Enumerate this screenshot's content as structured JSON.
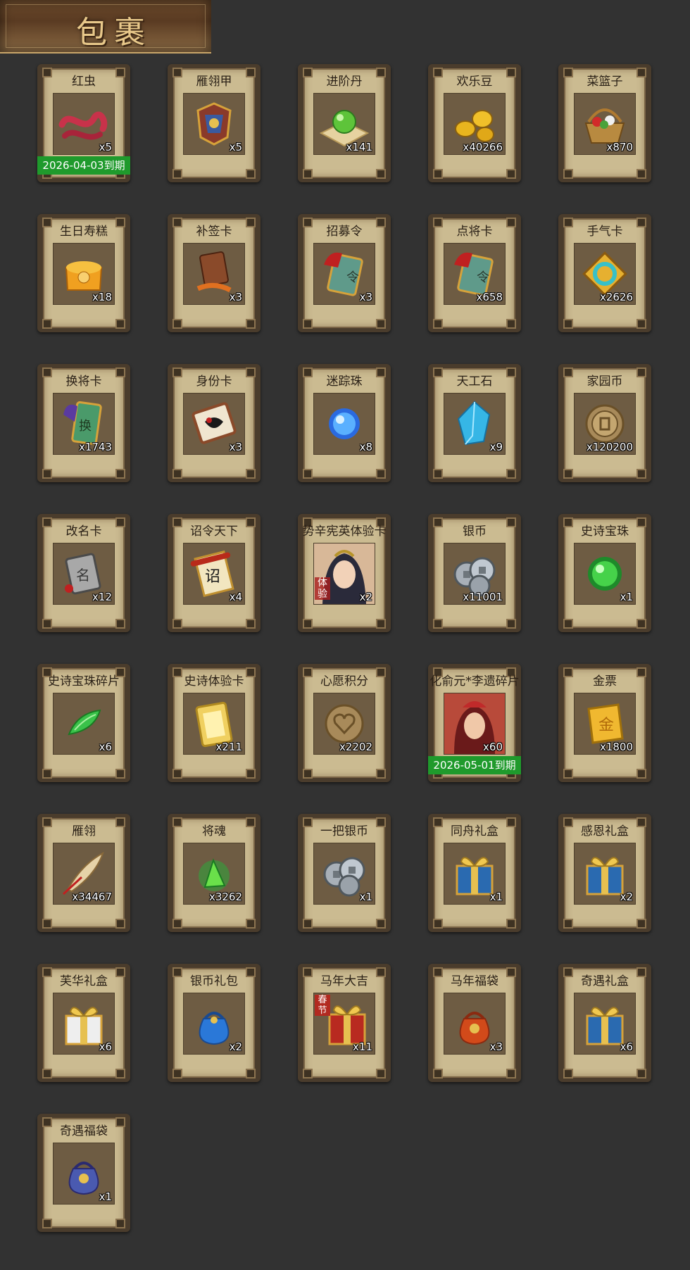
{
  "header": {
    "title": "包裹"
  },
  "items": [
    {
      "name": "红虫",
      "qty": "x5",
      "expiry": "2026-04-03到期",
      "icon": "red-worm-icon",
      "art": "worm"
    },
    {
      "name": "雁翎甲",
      "qty": "x5",
      "icon": "feather-armor-icon",
      "art": "armor"
    },
    {
      "name": "进阶丹",
      "qty": "x141",
      "icon": "advance-pill-icon",
      "art": "greenorb"
    },
    {
      "name": "欢乐豆",
      "qty": "x40266",
      "icon": "happy-bean-icon",
      "art": "beans"
    },
    {
      "name": "菜篮子",
      "qty": "x870",
      "icon": "basket-icon",
      "art": "basket"
    },
    {
      "name": "生日寿糕",
      "qty": "x18",
      "icon": "birthday-cake-icon",
      "art": "cake"
    },
    {
      "name": "补签卡",
      "qty": "x3",
      "icon": "makeup-sign-card-icon",
      "art": "signcard"
    },
    {
      "name": "招募令",
      "qty": "x3",
      "icon": "recruit-order-icon",
      "art": "token"
    },
    {
      "name": "点将卡",
      "qty": "x658",
      "icon": "general-pick-card-icon",
      "art": "token"
    },
    {
      "name": "手气卡",
      "qty": "x2626",
      "icon": "luck-card-icon",
      "art": "luck"
    },
    {
      "name": "换将卡",
      "qty": "x1743",
      "icon": "swap-general-card-icon",
      "art": "swap"
    },
    {
      "name": "身份卡",
      "qty": "x3",
      "icon": "identity-card-icon",
      "art": "mask"
    },
    {
      "name": "迷踪珠",
      "qty": "x8",
      "icon": "mystery-pearl-icon",
      "art": "blueorb"
    },
    {
      "name": "天工石",
      "qty": "x9",
      "icon": "crafting-stone-icon",
      "art": "crystal"
    },
    {
      "name": "家园币",
      "qty": "x120200",
      "icon": "home-coin-icon",
      "art": "coin"
    },
    {
      "name": "改名卡",
      "qty": "x12",
      "icon": "rename-card-icon",
      "art": "rename"
    },
    {
      "name": "诏令天下",
      "qty": "x4",
      "icon": "decree-scroll-icon",
      "art": "scroll"
    },
    {
      "name": "势辛宪英体验卡",
      "qty": "x2",
      "icon": "hero-trial-card-icon",
      "art": "portrait",
      "tag": "体验"
    },
    {
      "name": "银币",
      "qty": "x11001",
      "icon": "silver-coin-icon",
      "art": "silver"
    },
    {
      "name": "史诗宝珠",
      "qty": "x1",
      "icon": "epic-orb-icon",
      "art": "epicorb"
    },
    {
      "name": "史诗宝珠碎片",
      "qty": "x6",
      "icon": "epic-orb-shard-icon",
      "art": "shard"
    },
    {
      "name": "史诗体验卡",
      "qty": "x211",
      "icon": "epic-trial-card-icon",
      "art": "goldcard"
    },
    {
      "name": "心愿积分",
      "qty": "x2202",
      "icon": "wish-points-icon",
      "art": "heartcoin"
    },
    {
      "name": "化俞元*李遗碎片",
      "qty": "x60",
      "expiry": "2026-05-01到期",
      "icon": "hero-shard-icon",
      "art": "portrait2"
    },
    {
      "name": "金票",
      "qty": "x1800",
      "icon": "gold-ticket-icon",
      "art": "ticket"
    },
    {
      "name": "雁翎",
      "qty": "x34467",
      "icon": "feather-icon",
      "art": "feather"
    },
    {
      "name": "将魂",
      "qty": "x3262",
      "icon": "general-soul-icon",
      "art": "soul"
    },
    {
      "name": "一把银币",
      "qty": "x1",
      "icon": "silver-coins-bundle-icon",
      "art": "silver"
    },
    {
      "name": "同舟礼盒",
      "qty": "x1",
      "icon": "gift-box-icon",
      "art": "giftblue"
    },
    {
      "name": "感恩礼盒",
      "qty": "x2",
      "icon": "gift-box-icon",
      "art": "giftblue"
    },
    {
      "name": "芙华礼盒",
      "qty": "x6",
      "icon": "gift-box-icon",
      "art": "giftwhite"
    },
    {
      "name": "银币礼包",
      "qty": "x2",
      "icon": "silver-gift-bag-icon",
      "art": "bagblue"
    },
    {
      "name": "马年大吉",
      "qty": "x11",
      "icon": "festival-gift-box-icon",
      "art": "giftred",
      "tag": "春节"
    },
    {
      "name": "马年福袋",
      "qty": "x3",
      "icon": "lucky-bag-icon",
      "art": "bagred"
    },
    {
      "name": "奇遇礼盒",
      "qty": "x6",
      "icon": "gift-box-icon",
      "art": "giftblue"
    },
    {
      "name": "奇遇福袋",
      "qty": "x1",
      "icon": "lucky-bag-icon",
      "art": "bagpurple"
    }
  ],
  "colors": {
    "background": "#323232",
    "card_frame": "#4a3c2c",
    "card_paper": "#cbbb91",
    "expiry_banner": "#1f9a2c"
  }
}
